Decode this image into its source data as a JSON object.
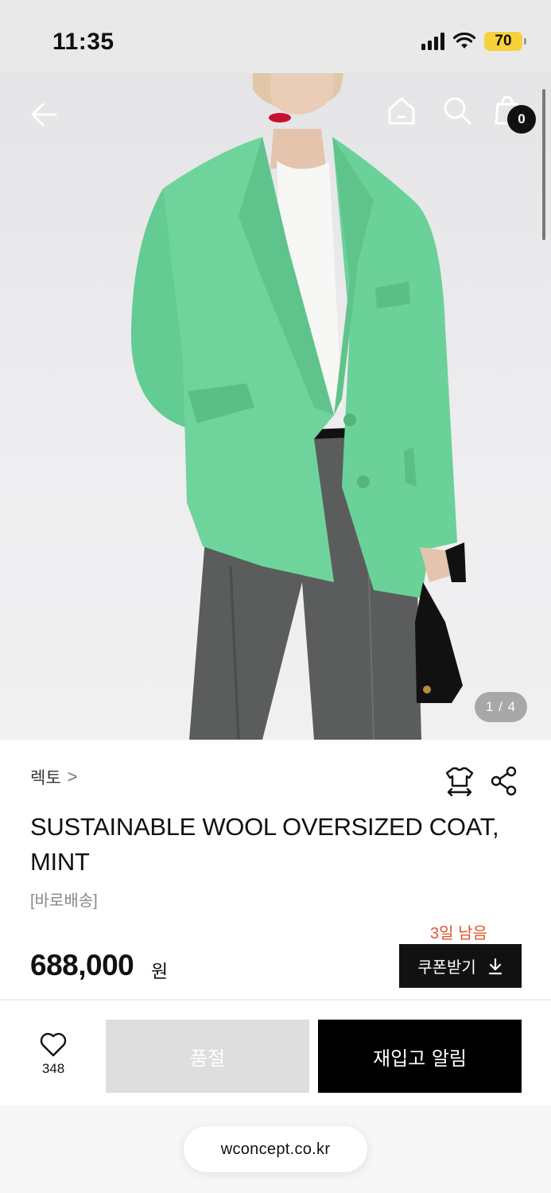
{
  "status_bar": {
    "time": "11:35",
    "battery": "70",
    "battery_color": "#f7d13a",
    "icons": [
      "signal-icon",
      "wifi-icon",
      "battery-icon"
    ]
  },
  "top_nav": {
    "icons": [
      "back-arrow-icon",
      "home-icon",
      "search-icon",
      "shopping-bag-icon"
    ],
    "cart_count": "0"
  },
  "gallery": {
    "indicator": "1 / 4",
    "image_description_colors": {
      "coat": "#6fd49b",
      "background": "#ebeaec"
    }
  },
  "product": {
    "brand": "렉토",
    "brand_chevron": ">",
    "title": "SUSTAINABLE WOOL OVERSIZED COAT, MINT",
    "shipping_tag": "[바로배송]",
    "days_left": "3일 남음",
    "price": "688,000",
    "price_unit": "원",
    "coupon_label": "쿠폰받기",
    "info_icons": [
      "size-guide-icon",
      "share-icon"
    ],
    "accent_color": "#e0552a"
  },
  "action_bar": {
    "wish_count": "348",
    "soldout_label": "품절",
    "restock_label": "재입고 알림"
  },
  "browser": {
    "url": "wconcept.co.kr"
  }
}
